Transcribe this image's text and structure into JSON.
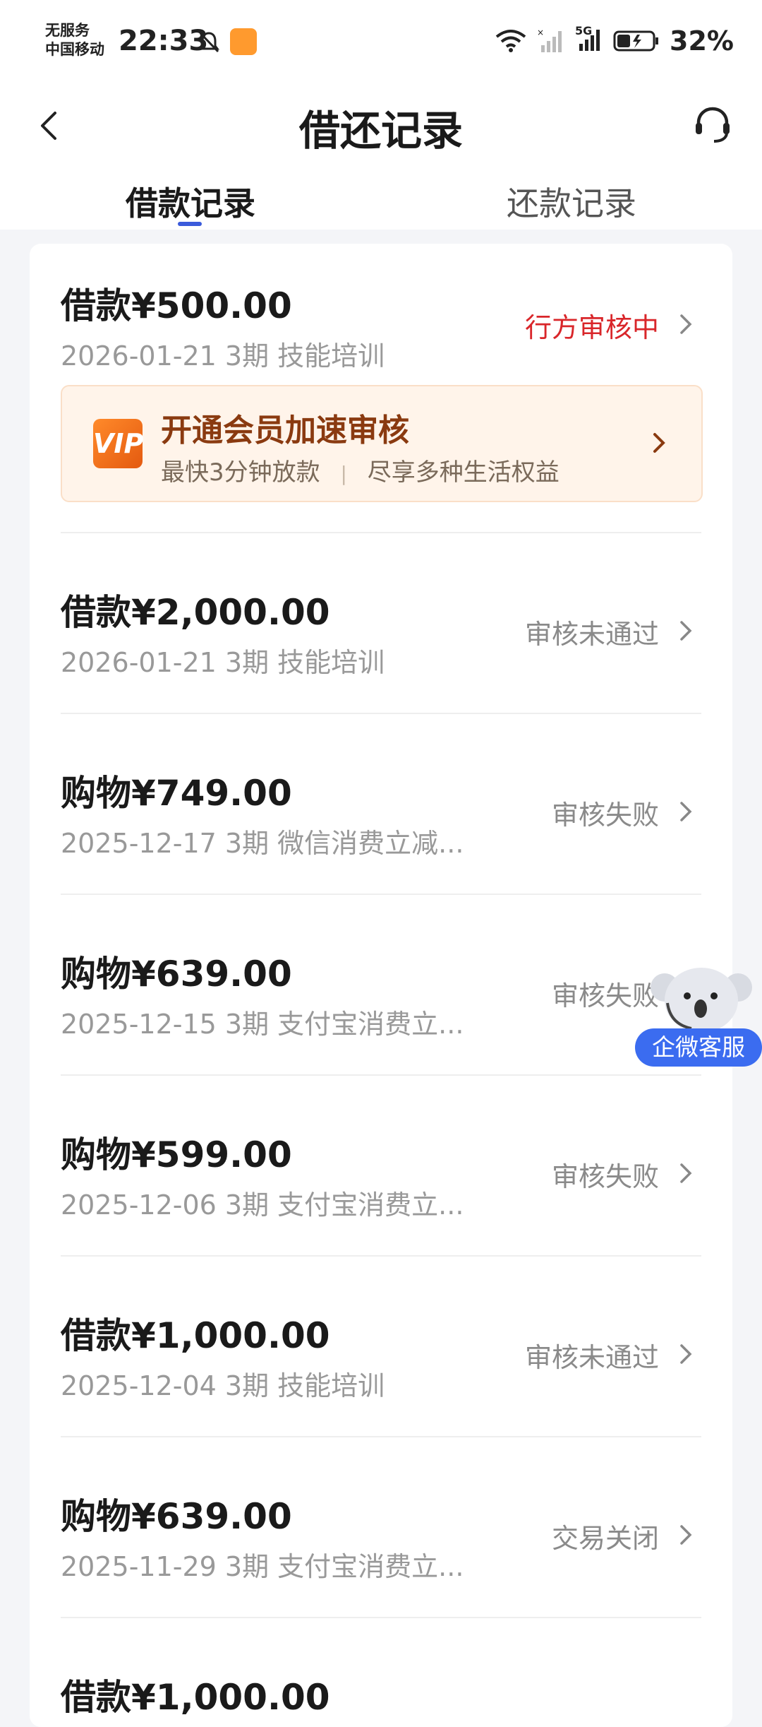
{
  "status_bar": {
    "carrier_line1": "无服务",
    "carrier_line2": "中国移动",
    "time": "22:33",
    "network": "5G",
    "battery": "32%"
  },
  "header": {
    "title": "借还记录",
    "back_icon": "chevron-left-icon",
    "support_icon": "headset-icon"
  },
  "tabs": [
    {
      "label": "借款记录",
      "active": true
    },
    {
      "label": "还款记录",
      "active": false
    }
  ],
  "vip_banner": {
    "logo_text": "VIP",
    "title": "开通会员加速审核",
    "desc_a": "最快3分钟放款",
    "desc_sep": "|",
    "desc_b": "尽享多种生活权益"
  },
  "records": [
    {
      "title": "借款¥500.00",
      "sub": "2026-01-21 3期  技能培训",
      "status": "行方审核中",
      "status_color": "#d9262a"
    },
    {
      "title": "借款¥2,000.00",
      "sub": "2026-01-21 3期  技能培训",
      "status": "审核未通过"
    },
    {
      "title": "购物¥749.00",
      "sub": "2025-12-17 3期  微信消费立减...",
      "status": "审核失败"
    },
    {
      "title": "购物¥639.00",
      "sub": "2025-12-15 3期  支付宝消费立...",
      "status": "审核失败"
    },
    {
      "title": "购物¥599.00",
      "sub": "2025-12-06 3期  支付宝消费立...",
      "status": "审核失败"
    },
    {
      "title": "借款¥1,000.00",
      "sub": "2025-12-04 3期  技能培训",
      "status": "审核未通过"
    },
    {
      "title": "购物¥639.00",
      "sub": "2025-11-29 3期  支付宝消费立...",
      "status": "交易关闭"
    },
    {
      "title": "借款¥1,000.00"
    }
  ],
  "floating_service": {
    "label": "企微客服"
  },
  "colors": {
    "accent": "#3b5bdb",
    "danger": "#d9262a",
    "vip": "#8a3a10"
  }
}
